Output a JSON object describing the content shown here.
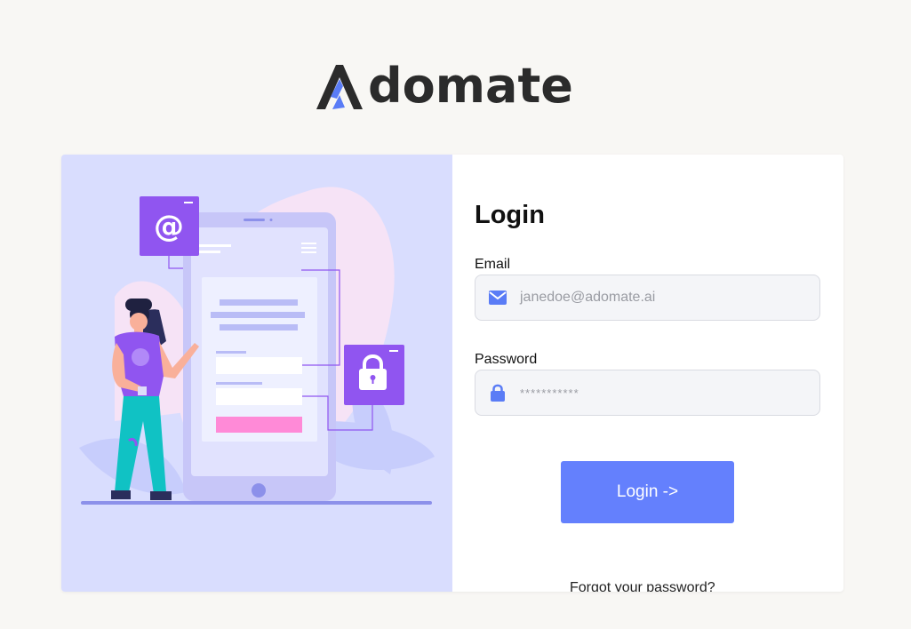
{
  "brand": {
    "name": "domate",
    "accent": "#5a7cf6",
    "dark": "#2b2b2b"
  },
  "login": {
    "title": "Login",
    "email_label": "Email",
    "email_placeholder": "janedoe@adomate.ai",
    "email_icon": "envelope-icon",
    "password_label": "Password",
    "password_placeholder": "***********",
    "password_icon": "lock-icon",
    "submit_label": "Login ->",
    "forgot_label": "Forgot your password?"
  },
  "illustration": {
    "badge_symbol": "@"
  },
  "colors": {
    "panel_bg": "#d9ddfe",
    "button": "#6480fd",
    "purple": "#9055f0",
    "page_bg": "#f8f7f4"
  }
}
